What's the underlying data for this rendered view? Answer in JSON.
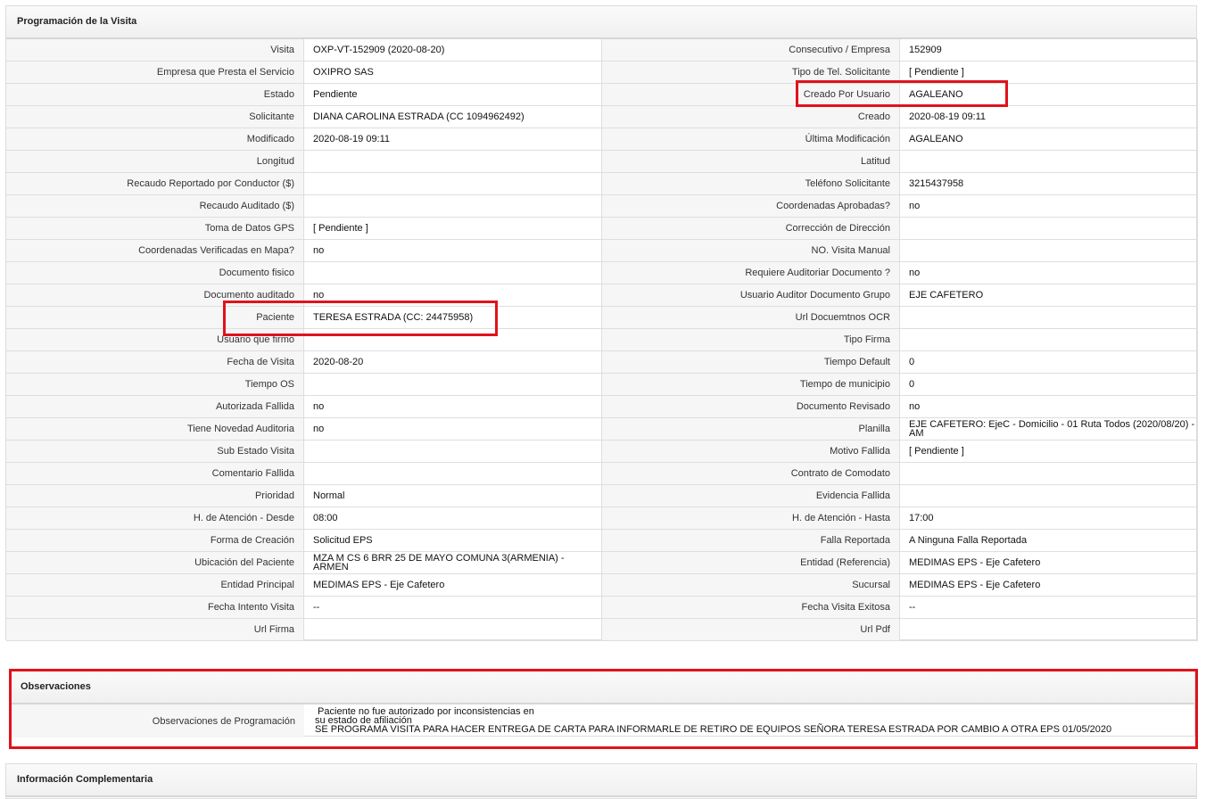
{
  "programacion": {
    "title": "Programación de la Visita",
    "left": [
      {
        "label": "Visita",
        "value": "OXP-VT-152909 (2020-08-20)"
      },
      {
        "label": "Empresa que Presta el Servicio",
        "value": "OXIPRO SAS"
      },
      {
        "label": "Estado",
        "value": "Pendiente"
      },
      {
        "label": "Solicitante",
        "value": "DIANA CAROLINA ESTRADA (CC 1094962492)"
      },
      {
        "label": "Modificado",
        "value": "2020-08-19 09:11"
      },
      {
        "label": "Longitud",
        "value": ""
      },
      {
        "label": "Recaudo Reportado por Conductor ($)",
        "value": ""
      },
      {
        "label": "Recaudo Auditado ($)",
        "value": ""
      },
      {
        "label": "Toma de Datos GPS",
        "value": "[ Pendiente ]"
      },
      {
        "label": "Coordenadas Verificadas en Mapa?",
        "value": "no"
      },
      {
        "label": "Documento fisico",
        "value": ""
      },
      {
        "label": "Documento auditado",
        "value": "no"
      },
      {
        "label": "Paciente",
        "value": "TERESA ESTRADA (CC: 24475958)"
      },
      {
        "label": "Usuario que firmo",
        "value": ""
      },
      {
        "label": "Fecha de Visita",
        "value": "2020-08-20"
      },
      {
        "label": "Tiempo OS",
        "value": ""
      },
      {
        "label": "Autorizada Fallida",
        "value": "no"
      },
      {
        "label": "Tiene Novedad Auditoria",
        "value": "no"
      },
      {
        "label": "Sub Estado Visita",
        "value": ""
      },
      {
        "label": "Comentario Fallida",
        "value": ""
      },
      {
        "label": "Prioridad",
        "value": "Normal"
      },
      {
        "label": "H. de Atención - Desde",
        "value": "08:00"
      },
      {
        "label": "Forma de Creación",
        "value": "Solicitud EPS"
      },
      {
        "label": "Ubicación del Paciente",
        "value": "MZA M CS 6 BRR 25 DE MAYO COMUNA 3(ARMENIA) - ARMEN"
      },
      {
        "label": "Entidad Principal",
        "value": "MEDIMAS EPS - Eje Cafetero"
      },
      {
        "label": "Fecha Intento Visita",
        "value": "--"
      },
      {
        "label": "Url Firma",
        "value": ""
      }
    ],
    "right": [
      {
        "label": "Consecutivo / Empresa",
        "value": "152909"
      },
      {
        "label": "Tipo de Tel. Solicitante",
        "value": "[ Pendiente ]"
      },
      {
        "label": "Creado Por Usuario",
        "value": "AGALEANO"
      },
      {
        "label": "Creado",
        "value": "2020-08-19 09:11"
      },
      {
        "label": "Última Modificación",
        "value": "AGALEANO"
      },
      {
        "label": "Latitud",
        "value": ""
      },
      {
        "label": "Teléfono Solicitante",
        "value": "3215437958"
      },
      {
        "label": "Coordenadas Aprobadas?",
        "value": "no"
      },
      {
        "label": "Corrección de Dirección",
        "value": ""
      },
      {
        "label": "NO. Visita Manual",
        "value": ""
      },
      {
        "label": "Requiere Auditoriar Documento ?",
        "value": "no"
      },
      {
        "label": "Usuario Auditor Documento Grupo",
        "value": "EJE CAFETERO"
      },
      {
        "label": "Url Docuemtnos OCR",
        "value": ""
      },
      {
        "label": "Tipo Firma",
        "value": ""
      },
      {
        "label": "Tiempo Default",
        "value": "0"
      },
      {
        "label": "Tiempo de municipio",
        "value": "0"
      },
      {
        "label": "Documento Revisado",
        "value": "no"
      },
      {
        "label": "Planilla",
        "value": "EJE CAFETERO: EjeC - Domicilio - 01 Ruta Todos (2020/08/20) - AM"
      },
      {
        "label": "Motivo Fallida",
        "value": "[ Pendiente ]"
      },
      {
        "label": "Contrato de Comodato",
        "value": ""
      },
      {
        "label": "Evidencia Fallida",
        "value": ""
      },
      {
        "label": "H. de Atención - Hasta",
        "value": "17:00"
      },
      {
        "label": "Falla Reportada",
        "value": "A Ninguna Falla Reportada"
      },
      {
        "label": "Entidad (Referencia)",
        "value": "MEDIMAS EPS - Eje Cafetero"
      },
      {
        "label": "Sucursal",
        "value": "MEDIMAS EPS - Eje Cafetero"
      },
      {
        "label": "Fecha Visita Exitosa",
        "value": "--"
      },
      {
        "label": "Url Pdf",
        "value": ""
      }
    ]
  },
  "observaciones": {
    "title": "Observaciones",
    "label": "Observaciones de Programación",
    "lines": [
      " Paciente no fue autorizado por inconsistencias en",
      "su estado de afiliación",
      "SE PROGRAMA VISITA PARA HACER ENTREGA DE CARTA PARA INFORMARLE DE RETIRO DE EQUIPOS SEÑORA TERESA ESTRADA POR CAMBIO A OTRA EPS 01/05/2020"
    ]
  },
  "complementaria": {
    "title": "Información Complementaria"
  },
  "highlight_color": "#e0121c"
}
